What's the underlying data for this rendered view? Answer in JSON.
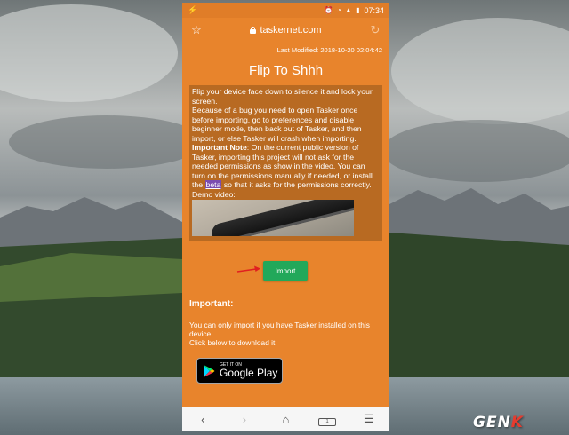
{
  "status_bar": {
    "left_icon": "lightning-icon",
    "icons": "alarm wifi signal battery",
    "time": "07:34"
  },
  "browser": {
    "url": "taskernet.com",
    "left_icon": "star-icon",
    "right_icon": "reload-icon"
  },
  "page": {
    "last_modified": "Last Modified: 2018-10-20 02:04:42",
    "title": "Flip To Shhh",
    "desc_line1": "Flip your device face down to silence it and lock your screen.",
    "desc_line2": "Because of a bug you need to open Tasker once before importing, go to preferences and disable beginner mode, then back out of Tasker, and then import, or else Tasker will crash when importing.",
    "important_note_label": "Important Note",
    "desc_line3a": ": On the current public version of Tasker, importing this project will not ask for the needed permissions as show in the video. You can turn on the permissions manually if needed, or install the ",
    "beta_link": "beta",
    "desc_line3b": " so that it asks for the permissions correctly.",
    "demo_label": "Demo video:",
    "import_button": "Import",
    "important_heading": "Important:",
    "important_line1": "You can only import if you have Tasker installed on this device",
    "important_line2": "Click below to download it",
    "gplay_small": "GET IT ON",
    "gplay_big": "Google Play"
  },
  "nav_bar": {
    "icons": [
      "back-icon",
      "forward-icon",
      "home-icon",
      "tabs-icon",
      "menu-icon"
    ],
    "tabs_count": "1"
  },
  "watermark": {
    "ge": "GEN",
    "k": "K"
  },
  "colors": {
    "page_bg": "#e8842c",
    "desc_bg": "#b86a22",
    "import_button": "#22a85a",
    "watermark_accent": "#e63b2e"
  }
}
